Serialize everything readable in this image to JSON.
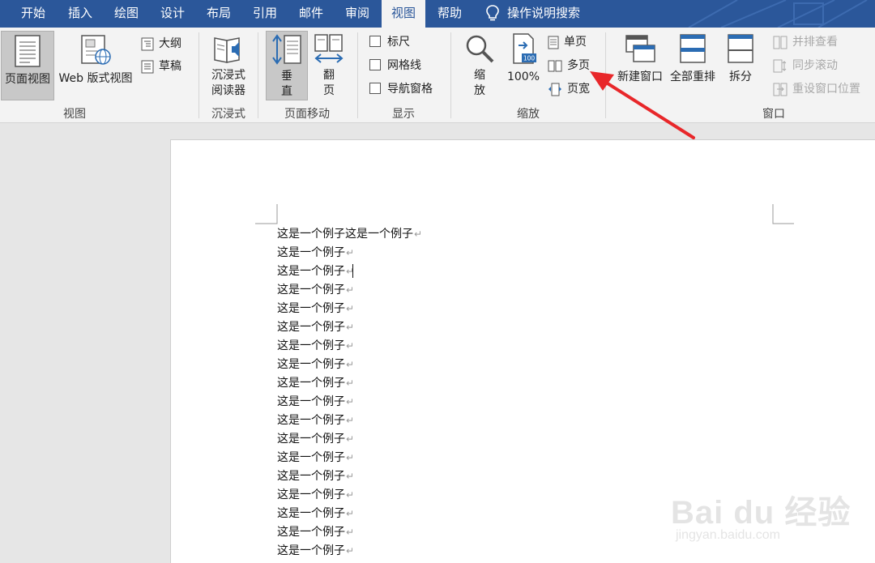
{
  "tabs": [
    {
      "label": "开始"
    },
    {
      "label": "插入"
    },
    {
      "label": "绘图"
    },
    {
      "label": "设计"
    },
    {
      "label": "布局"
    },
    {
      "label": "引用"
    },
    {
      "label": "邮件"
    },
    {
      "label": "审阅"
    },
    {
      "label": "视图",
      "active": true
    },
    {
      "label": "帮助"
    }
  ],
  "search": {
    "label": "操作说明搜索",
    "icon": "lightbulb-icon"
  },
  "ribbon": {
    "views": {
      "print_layout": "页面视图",
      "web_layout": "Web 版式视图",
      "outline": "大纲",
      "draft": "草稿",
      "group": "视图"
    },
    "immersive": {
      "reader_line1": "沉浸式",
      "reader_line2": "阅读器",
      "group": "沉浸式"
    },
    "page_move": {
      "vertical_line1": "垂",
      "vertical_line2": "直",
      "flip_line1": "翻",
      "flip_line2": "页",
      "group": "页面移动"
    },
    "show": {
      "ruler": "标尺",
      "gridlines": "网格线",
      "nav_pane": "导航窗格",
      "group": "显示"
    },
    "zoom": {
      "zoom_line1": "缩",
      "zoom_line2": "放",
      "percent": "100%",
      "percent_badge": "100",
      "one_page": "单页",
      "multi_page": "多页",
      "page_width": "页宽",
      "group": "缩放"
    },
    "window": {
      "new_window": "新建窗口",
      "arrange_all": "全部重排",
      "split": "拆分",
      "side_by_side": "并排查看",
      "sync_scroll": "同步滚动",
      "reset_position": "重设窗口位置",
      "group": "窗口"
    }
  },
  "document": {
    "lines": [
      "这是一个例子这是一个例子",
      "这是一个例子",
      "这是一个例子",
      "这是一个例子",
      "这是一个例子",
      "这是一个例子",
      "这是一个例子",
      "这是一个例子",
      "这是一个例子",
      "这是一个例子",
      "这是一个例子",
      "这是一个例子",
      "这是一个例子",
      "这是一个例子",
      "这是一个例子",
      "这是一个例子",
      "这是一个例子",
      "这是一个例子"
    ],
    "return_mark": "↵"
  },
  "watermark": {
    "brand": "Bai du 经验",
    "url": "jingyan.baidu.com"
  },
  "colors": {
    "accent": "#2b579a",
    "ribbon_bg": "#f3f3f3",
    "arrow": "#e8272a"
  }
}
